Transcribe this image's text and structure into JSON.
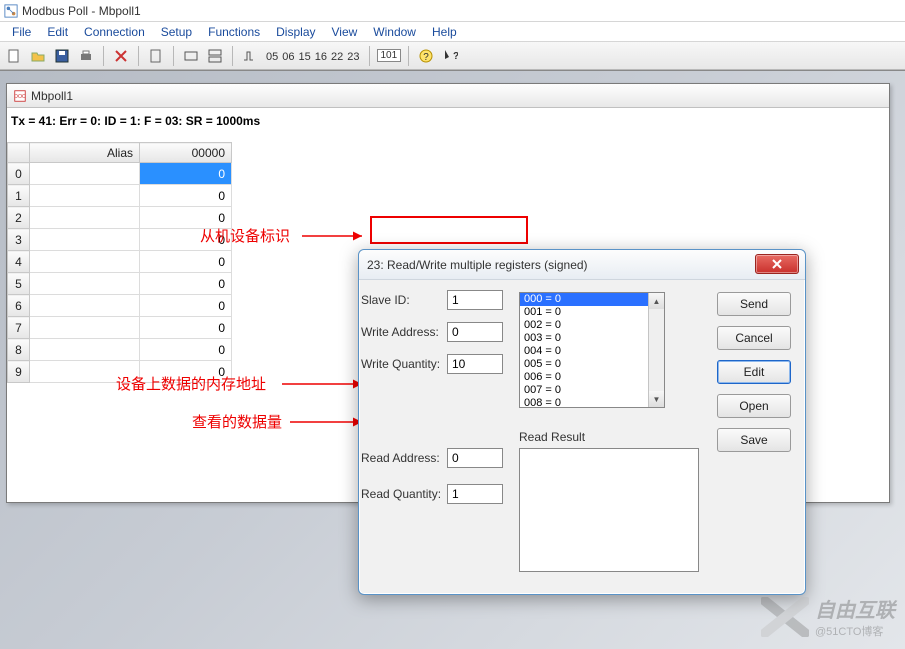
{
  "window": {
    "title": "Modbus Poll - Mbpoll1"
  },
  "menu": {
    "file": "File",
    "edit": "Edit",
    "connection": "Connection",
    "setup": "Setup",
    "functions": "Functions",
    "display": "Display",
    "view": "View",
    "window": "Window",
    "help": "Help"
  },
  "toolbar_nums": [
    "05",
    "06",
    "15",
    "16",
    "22",
    "23"
  ],
  "toolbar_box": "101",
  "doc": {
    "title": "Mbpoll1",
    "status": "Tx = 41: Err = 0: ID = 1: F = 03: SR = 1000ms",
    "columns": {
      "alias": "Alias",
      "val": "00000"
    },
    "rows": [
      {
        "idx": "0",
        "alias": "",
        "val": "0",
        "selected": true
      },
      {
        "idx": "1",
        "alias": "",
        "val": "0"
      },
      {
        "idx": "2",
        "alias": "",
        "val": "0"
      },
      {
        "idx": "3",
        "alias": "",
        "val": "0"
      },
      {
        "idx": "4",
        "alias": "",
        "val": "0"
      },
      {
        "idx": "5",
        "alias": "",
        "val": "0"
      },
      {
        "idx": "6",
        "alias": "",
        "val": "0"
      },
      {
        "idx": "7",
        "alias": "",
        "val": "0"
      },
      {
        "idx": "8",
        "alias": "",
        "val": "0"
      },
      {
        "idx": "9",
        "alias": "",
        "val": "0"
      }
    ]
  },
  "annotations": {
    "slave_id": "从机设备标识",
    "read_addr": "设备上数据的内存地址",
    "read_qty": "查看的数据量"
  },
  "dialog": {
    "title": "23: Read/Write multiple registers (signed)",
    "labels": {
      "slave_id": "Slave ID:",
      "write_addr": "Write Address:",
      "write_qty": "Write Quantity:",
      "read_addr": "Read Address:",
      "read_qty": "Read Quantity:",
      "read_result": "Read Result"
    },
    "values": {
      "slave_id": "1",
      "write_addr": "0",
      "write_qty": "10",
      "read_addr": "0",
      "read_qty": "1"
    },
    "registers": [
      "000 = 0",
      "001 = 0",
      "002 = 0",
      "003 = 0",
      "004 = 0",
      "005 = 0",
      "006 = 0",
      "007 = 0",
      "008 = 0"
    ],
    "registers_selected": 0,
    "buttons": {
      "send": "Send",
      "cancel": "Cancel",
      "edit": "Edit",
      "open": "Open",
      "save": "Save"
    }
  },
  "watermark": {
    "brand": "自由互联",
    "sub": "@51CTO博客"
  }
}
